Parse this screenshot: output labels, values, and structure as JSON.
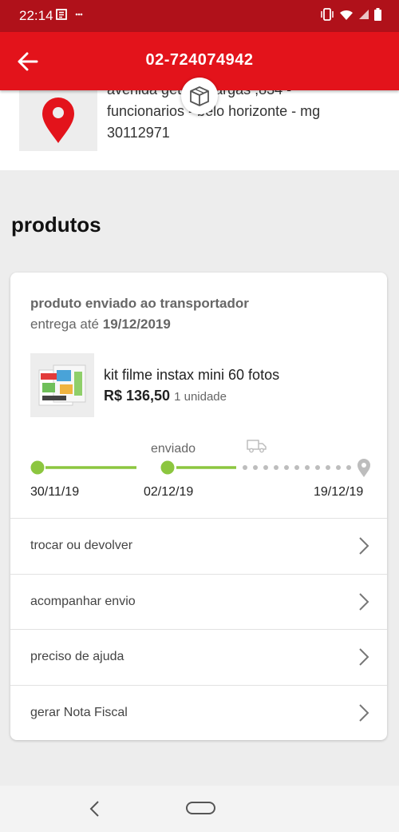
{
  "status_bar": {
    "time": "22:14"
  },
  "app_bar": {
    "title": "02-724074942"
  },
  "address": {
    "line1": "avenida getúlio vargas ,834 -",
    "line2": "funcionarios - belo horizonte - mg",
    "line3": "30112971"
  },
  "section": {
    "title": "produtos"
  },
  "order": {
    "status": "produto enviado ao transportador",
    "delivery_prefix": "entrega até",
    "delivery_date": "19/12/2019",
    "product": {
      "name": "kit filme instax mini 60 fotos",
      "price": "R$ 136,50",
      "quantity": "1 unidade"
    },
    "timeline": {
      "current_label": "enviado",
      "dates": [
        "30/11/19",
        "02/12/19",
        "19/12/19"
      ]
    },
    "actions": [
      {
        "label": "trocar ou devolver"
      },
      {
        "label": "acompanhar envio"
      },
      {
        "label": "preciso de ajuda"
      },
      {
        "label": "gerar Nota Fiscal"
      }
    ]
  },
  "colors": {
    "brand_red": "#e3131b",
    "status_bar_red": "#b0111a",
    "progress_green": "#8cc63f",
    "pending_gray": "#bdbdbd"
  },
  "icons": [
    "back-arrow-icon",
    "location-pin-icon",
    "package-box-icon",
    "delivery-truck-icon",
    "map-pin-icon",
    "chevron-right-icon"
  ]
}
